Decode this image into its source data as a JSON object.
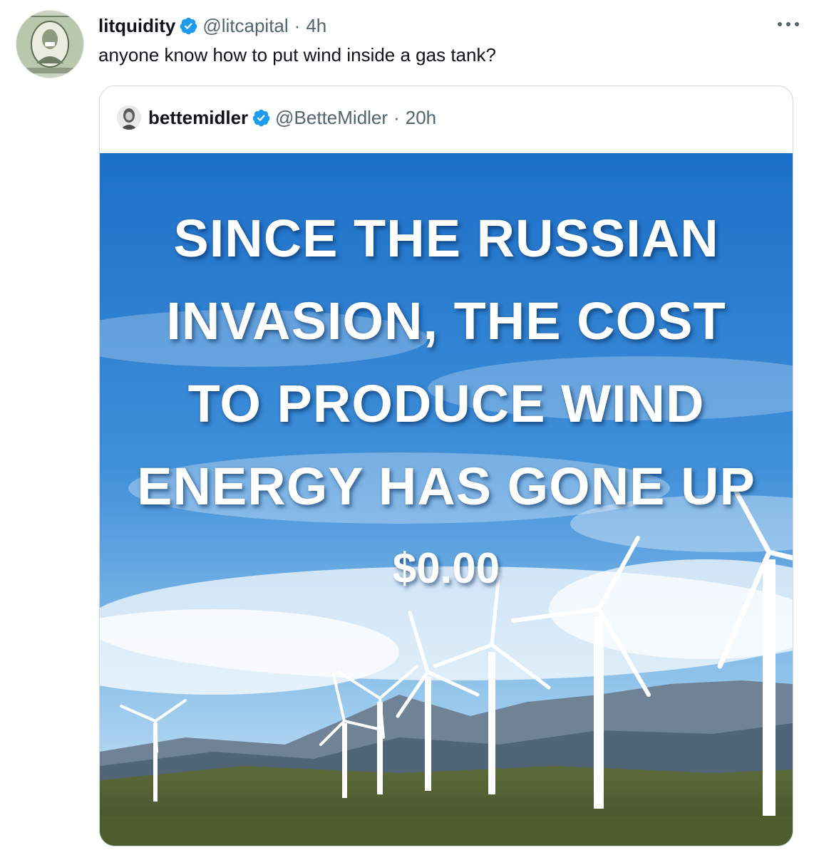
{
  "tweet": {
    "display_name": "litquidity",
    "handle": "@litcapital",
    "separator": "·",
    "time": "4h",
    "text": "anyone know how to put wind inside a gas tank?",
    "more_icon": "ellipsis-icon"
  },
  "quoted_tweet": {
    "display_name": "bettemidler",
    "handle": "@BetteMidler",
    "separator": "·",
    "time": "20h",
    "image": {
      "caption_lines": [
        "SINCE THE RUSSIAN",
        "INVASION, THE COST",
        "TO PRODUCE WIND",
        "ENERGY HAS GONE UP"
      ],
      "price": "$0.00"
    }
  },
  "colors": {
    "verified": "#1d9bf0",
    "secondary_text": "#536471",
    "border": "#cfd9de",
    "sky_top": "#1f78d1",
    "sky_bottom": "#bfe0f5"
  }
}
